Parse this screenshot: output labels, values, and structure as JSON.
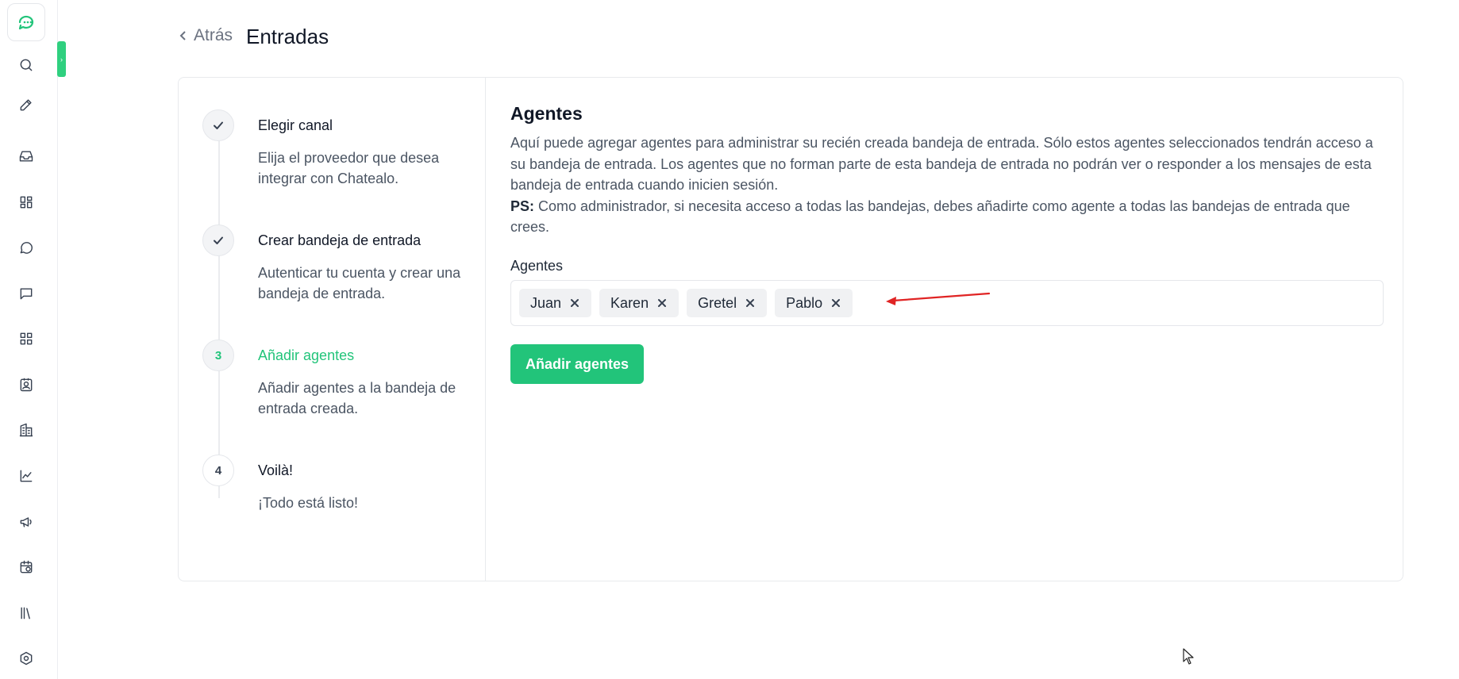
{
  "header": {
    "back_label": "Atrás",
    "title": "Entradas"
  },
  "steps": [
    {
      "indicator": "",
      "state": "done",
      "title": "Elegir canal",
      "description": "Elija el proveedor que desea integrar con Chatealo."
    },
    {
      "indicator": "",
      "state": "done",
      "title": "Crear bandeja de entrada",
      "description": "Autenticar tu cuenta y crear una bandeja de entrada."
    },
    {
      "indicator": "3",
      "state": "active",
      "title": "Añadir agentes",
      "description": "Añadir agentes a la bandeja de entrada creada."
    },
    {
      "indicator": "4",
      "state": "pending",
      "title": "Voilà!",
      "description": "¡Todo está listo!"
    }
  ],
  "content": {
    "title": "Agentes",
    "description": "Aquí puede agregar agentes para administrar su recién creada bandeja de entrada. Sólo estos agentes seleccionados tendrán acceso a su bandeja de entrada. Los agentes que no forman parte de esta bandeja de entrada no podrán ver o responder a los mensajes de esta bandeja de entrada cuando inicien sesión.",
    "ps_label": "PS:",
    "ps_text": " Como administrador, si necesita acceso a todas las bandejas, debes añadirte como agente a todas las bandejas de entrada que crees.",
    "field_label": "Agentes",
    "selected_agents": [
      "Juan",
      "Karen",
      "Gretel",
      "Pablo"
    ],
    "submit_label": "Añadir agentes"
  },
  "sidebar_icons": [
    "search-icon",
    "compose-icon",
    "inbox-icon",
    "dashboard-icon",
    "conversations-icon",
    "messages-icon",
    "apps-icon",
    "contacts-icon",
    "companies-icon",
    "reports-icon",
    "campaigns-icon",
    "schedule-icon",
    "library-icon",
    "settings-icon"
  ],
  "colors": {
    "accent": "#22c47a",
    "annotation_arrow": "#e02424"
  }
}
